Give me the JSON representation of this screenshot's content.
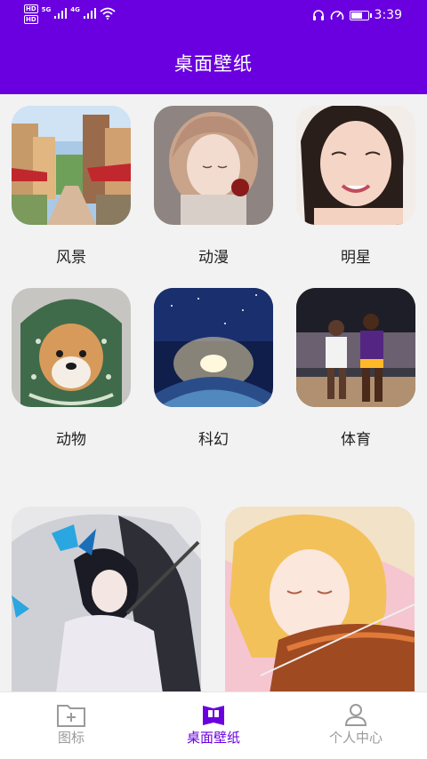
{
  "status_bar": {
    "hd_top": "HD",
    "hd_bottom": "HD",
    "net_top": "5G",
    "net_bottom": "4G",
    "time": "3:39",
    "battery_level": 0.75
  },
  "header": {
    "title": "桌面壁纸"
  },
  "categories": [
    {
      "label": "风景",
      "icon": "landscape-thumbnail"
    },
    {
      "label": "动漫",
      "icon": "anime-thumbnail"
    },
    {
      "label": "明星",
      "icon": "celebrity-thumbnail"
    },
    {
      "label": "动物",
      "icon": "animal-thumbnail"
    },
    {
      "label": "科幻",
      "icon": "scifi-thumbnail"
    },
    {
      "label": "体育",
      "icon": "sports-thumbnail"
    }
  ],
  "featured": [
    {
      "icon": "featured-anime-swordswoman"
    },
    {
      "icon": "featured-anime-violinist"
    }
  ],
  "bottom_nav": {
    "items": [
      {
        "label": "图标",
        "icon": "icon-folder-icon",
        "active": false
      },
      {
        "label": "桌面壁纸",
        "icon": "wallpaper-book-icon",
        "active": true
      },
      {
        "label": "个人中心",
        "icon": "person-icon",
        "active": false
      }
    ],
    "active_color": "#6a00e0",
    "inactive_color": "#9a9a9a"
  },
  "colors": {
    "primary": "#6a00e0",
    "background": "#f2f2f2"
  }
}
